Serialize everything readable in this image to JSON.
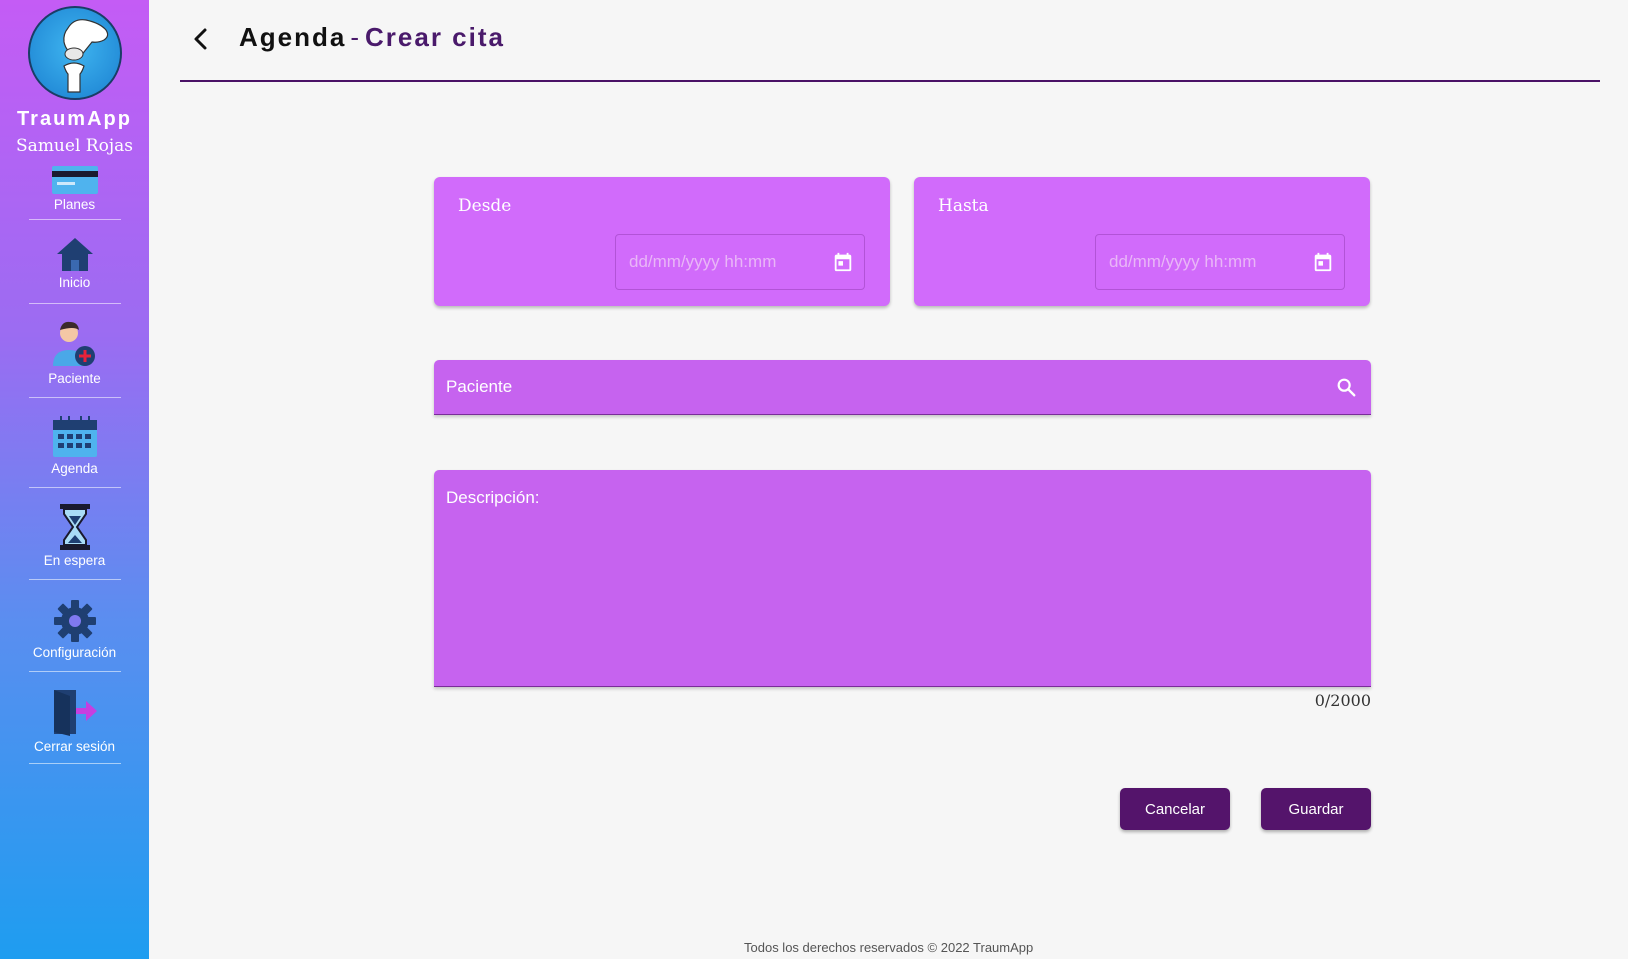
{
  "sidebar": {
    "brand": "TraumApp",
    "user": "Samuel Rojas",
    "items": [
      {
        "label": "Planes",
        "icon": "credit-card-icon"
      },
      {
        "label": "Inicio",
        "icon": "home-icon"
      },
      {
        "label": "Paciente",
        "icon": "patient-add-icon"
      },
      {
        "label": "Agenda",
        "icon": "calendar-icon"
      },
      {
        "label": "En espera",
        "icon": "hourglass-icon"
      },
      {
        "label": "Configuración",
        "icon": "gear-icon"
      },
      {
        "label": "Cerrar sesión",
        "icon": "logout-door-icon"
      }
    ]
  },
  "header": {
    "title": "Agenda",
    "separator": "-",
    "subtitle": "Crear cita"
  },
  "form": {
    "from": {
      "label": "Desde",
      "placeholder": "dd/mm/yyyy hh:mm"
    },
    "to": {
      "label": "Hasta",
      "placeholder": "dd/mm/yyyy hh:mm"
    },
    "patient_placeholder": "Paciente",
    "description_placeholder": "Descripción:",
    "char_counter": "0/2000",
    "cancel_label": "Cancelar",
    "save_label": "Guardar"
  },
  "footer": "Todos los derechos reservados © 2022 TraumApp",
  "colors": {
    "accent": "#54146b",
    "card": "#d16bfb",
    "field": "#c663ef"
  }
}
